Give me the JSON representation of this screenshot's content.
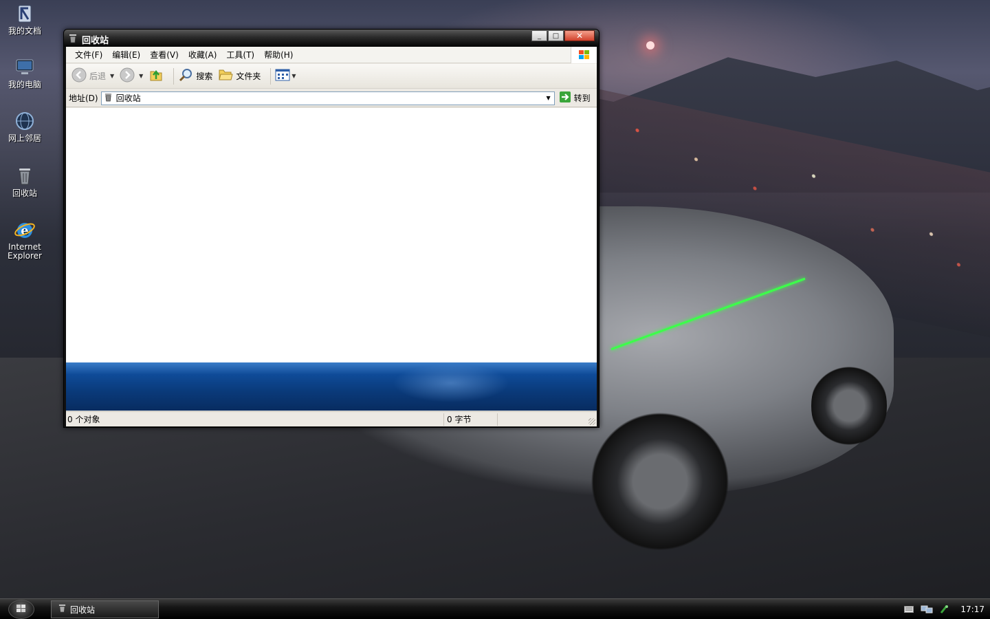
{
  "desktop": {
    "icons": [
      {
        "label": "我的文档"
      },
      {
        "label": "我的电脑"
      },
      {
        "label": "网上邻居"
      },
      {
        "label": "回收站"
      },
      {
        "label": "Internet Explorer"
      }
    ]
  },
  "window": {
    "title": "回收站",
    "caption_minimize": "_",
    "caption_maximize": "□",
    "caption_close": "✕",
    "menu": [
      "文件(F)",
      "编辑(E)",
      "查看(V)",
      "收藏(A)",
      "工具(T)",
      "帮助(H)"
    ],
    "toolbar": {
      "back": "后退",
      "search": "搜索",
      "folders": "文件夹"
    },
    "address": {
      "label": "地址(D)",
      "value": "回收站",
      "go": "转到"
    },
    "status": {
      "objects": "0 个对象",
      "size": "0 字节"
    }
  },
  "taskbar": {
    "task_label": "回收站",
    "clock": "17:17"
  },
  "colors": {
    "title_bar": "#111111",
    "banner_blue": "#0f4b98",
    "go_green": "#3aa53a"
  }
}
